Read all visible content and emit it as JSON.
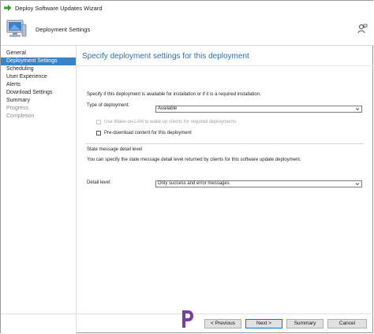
{
  "window": {
    "title": "Deploy Software Updates Wizard"
  },
  "header": {
    "title": "Deployment Settings"
  },
  "sidebar": {
    "items": [
      {
        "label": "General",
        "state": "normal"
      },
      {
        "label": "Deployment Settings",
        "state": "active"
      },
      {
        "label": "Scheduling",
        "state": "normal"
      },
      {
        "label": "User Experience",
        "state": "normal"
      },
      {
        "label": "Alerts",
        "state": "normal"
      },
      {
        "label": "Download Settings",
        "state": "normal"
      },
      {
        "label": "Summary",
        "state": "normal"
      },
      {
        "label": "Progress",
        "state": "disabled"
      },
      {
        "label": "Completion",
        "state": "disabled"
      }
    ]
  },
  "main": {
    "heading": "Specify deployment settings for this deployment",
    "intro": "Specify if this deployment is available for installation or if it is a required installation.",
    "type_label": "Type of deployment:",
    "type_value": "Available",
    "wol_label": "Use Wake-on-LAN to wake up clients for required deployments",
    "predownload_label": "Pre-download content for this deployment",
    "state_heading": "State message detail level",
    "state_desc": "You can specify the state message detail level returned by clients for this software update deployment.",
    "detail_label": "Detail level:",
    "detail_value": "Only success and error messages"
  },
  "buttons": {
    "previous": "< Previous",
    "next": "Next >",
    "summary": "Summary",
    "cancel": "Cancel"
  },
  "colors": {
    "accent": "#3a82c8",
    "heading": "#2e6fb5",
    "title_arrow": "#2aa52a",
    "logo": "#7b3fa0"
  }
}
